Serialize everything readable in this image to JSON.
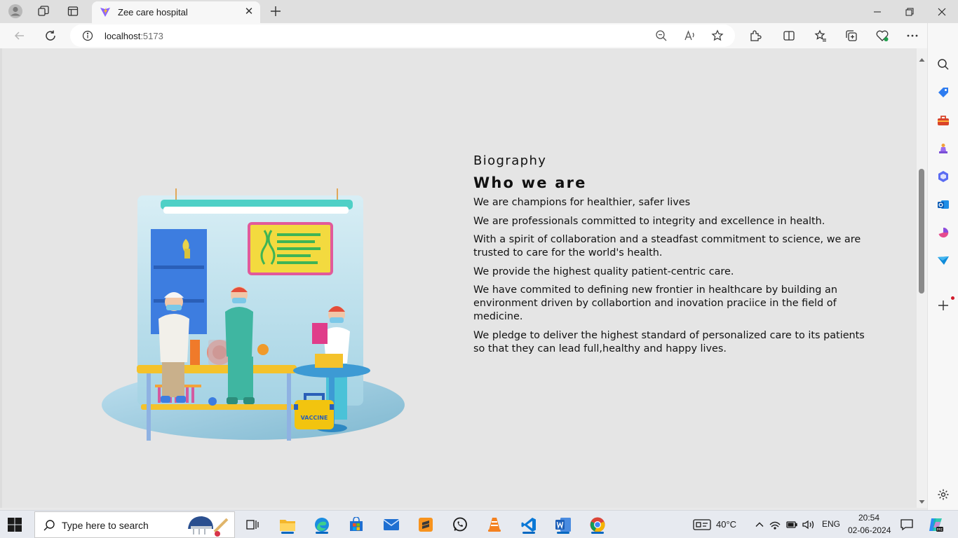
{
  "browser": {
    "tab_title": "Zee care hospital",
    "url_host": "localhost",
    "url_port": ":5173"
  },
  "biography": {
    "subtitle": "Biography",
    "title": "Who we are",
    "paragraphs": [
      "We are champions for healthier, safer lives",
      "We are professionals committed to integrity and excellence in health.",
      "With a spirit of collaboration and a steadfast commitment to science, we are trusted to care for the world's health.",
      "We provide the highest quality patient-centric care.",
      "We have commited to defining new frontier in healthcare by building an environment driven by collabortion and inovation praciice in the field of medicine.",
      "We pledge to deliver the highest standard of personalized care to its patients so that they can lead full,healthy and happy lives."
    ]
  },
  "illustration": {
    "case_label": "VACCINE"
  },
  "taskbar": {
    "search_placeholder": "Type here to search",
    "weather": "40°C",
    "language": "ENG",
    "time": "20:54",
    "date": "02-06-2024"
  },
  "colors": {
    "page_bg": "#e5e5e5",
    "edge_blue": "#0067c0",
    "case_yellow": "#f2c40f"
  },
  "icons": {
    "sidebar": [
      "search-icon",
      "tag-icon",
      "toolbox-icon",
      "chess-icon",
      "copilot-icon",
      "outlook-icon",
      "drop-icon",
      "send-icon",
      "add-icon",
      "settings-icon"
    ]
  }
}
